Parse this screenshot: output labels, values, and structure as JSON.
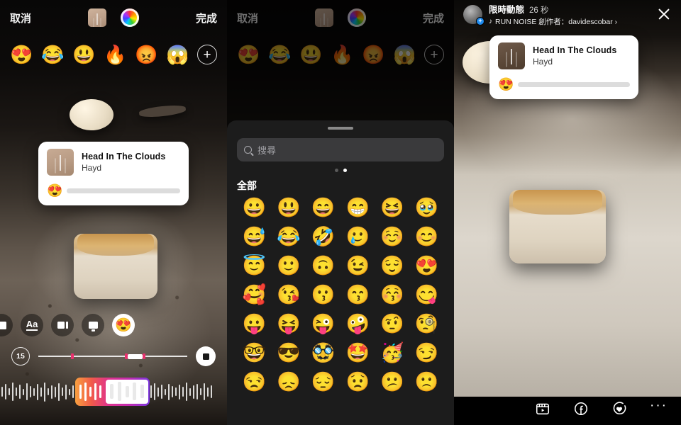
{
  "editor": {
    "cancel_label": "取消",
    "done_label": "完成",
    "album_art_name": "album-art",
    "color_wheel_name": "color-wheel",
    "quick_emojis": [
      "😍",
      "😂",
      "😃",
      "🔥",
      "😡",
      "😱"
    ],
    "add_emoji_label": "+",
    "duration_badge": "15",
    "tools": [
      {
        "name": "sticker-tool",
        "label": ""
      },
      {
        "name": "text-tool",
        "label": "Aa"
      },
      {
        "name": "effects-tool",
        "label": ""
      },
      {
        "name": "draw-tool",
        "label": ""
      },
      {
        "name": "emoji-slider-tool",
        "label": "😍"
      }
    ]
  },
  "music_card": {
    "title": "Head In The Clouds",
    "artist": "Hayd",
    "slider_emoji": "😍"
  },
  "emoji_sheet": {
    "search_placeholder": "搜尋",
    "section_title": "全部",
    "page_dots": 2,
    "active_dot": 2,
    "rows": [
      [
        "😀",
        "😃",
        "😄",
        "😁",
        "😆",
        "🥹"
      ],
      [
        "😅",
        "😂",
        "🤣",
        "🥲",
        "☺️",
        "😊"
      ],
      [
        "😇",
        "🙂",
        "🙃",
        "😉",
        "😌",
        "😍"
      ],
      [
        "🥰",
        "😘",
        "😗",
        "😙",
        "😚",
        "😋"
      ],
      [
        "😛",
        "😝",
        "😜",
        "🤪",
        "🤨",
        "🧐"
      ],
      [
        "🤓",
        "😎",
        "🥸",
        "🤩",
        "🥳",
        "😏"
      ],
      [
        "😒",
        "😞",
        "😔",
        "😟",
        "😕",
        "🙁"
      ]
    ]
  },
  "story": {
    "label": "限時動態",
    "time": "26 秒",
    "music_note": "♪",
    "music_credit": "RUN NOISE 創作者：davidescobar ›",
    "close_label": "×",
    "avatar_badge": "+",
    "actions": [
      {
        "name": "reels-icon"
      },
      {
        "name": "facebook-icon"
      },
      {
        "name": "heart-icon"
      },
      {
        "name": "more-icon",
        "glyph": "···"
      }
    ]
  }
}
